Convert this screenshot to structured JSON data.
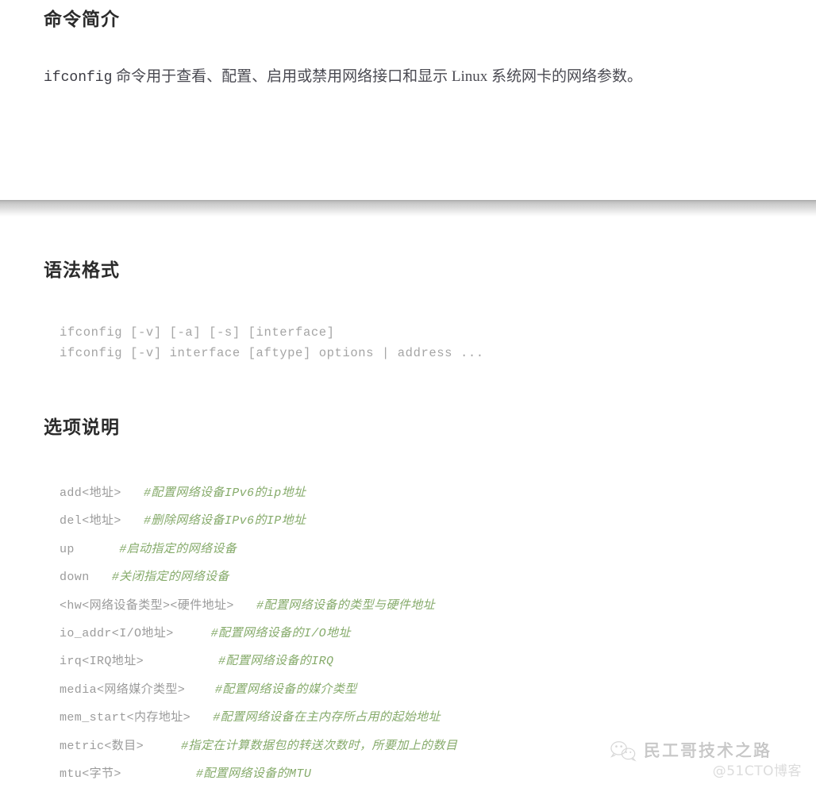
{
  "document": {
    "background_color": "#ffffff",
    "heading_color": "#2b2b2b",
    "body_color": "#4a4a52",
    "code_color": "#a5a5a5",
    "option_name_color": "#9b9b9b",
    "comment_color": "#86ab6b"
  },
  "intro": {
    "heading": "命令简介",
    "command_name": "ifconfig",
    "paragraph_rest": " 命令用于查看、配置、启用或禁用网络接口和显示 Linux 系统网卡的网络参数。"
  },
  "syntax": {
    "heading": "语法格式",
    "lines": [
      "ifconfig [-v] [-a] [-s] [interface]",
      "ifconfig [-v] interface [aftype] options | address ..."
    ],
    "code_text": "ifconfig [-v] [-a] [-s] [interface]\nifconfig [-v] interface [aftype] options | address ..."
  },
  "options": {
    "heading": "选项说明",
    "rows": [
      {
        "name": "add<地址>",
        "gap": "   ",
        "comment": "#配置网络设备IPv6的ip地址"
      },
      {
        "name": "del<地址>",
        "gap": "   ",
        "comment": "#删除网络设备IPv6的IP地址"
      },
      {
        "name": "up",
        "gap": "      ",
        "comment": "#启动指定的网络设备"
      },
      {
        "name": "down",
        "gap": "   ",
        "comment": "#关闭指定的网络设备"
      },
      {
        "name": "<hw<网络设备类型><硬件地址>",
        "gap": "   ",
        "comment": "#配置网络设备的类型与硬件地址"
      },
      {
        "name": "io_addr<I/O地址>",
        "gap": "     ",
        "comment": "#配置网络设备的I/O地址"
      },
      {
        "name": "irq<IRQ地址>",
        "gap": "          ",
        "comment": "#配置网络设备的IRQ"
      },
      {
        "name": "media<网络媒介类型>",
        "gap": "    ",
        "comment": "#配置网络设备的媒介类型"
      },
      {
        "name": "mem_start<内存地址>",
        "gap": "   ",
        "comment": "#配置网络设备在主内存所占用的起始地址"
      },
      {
        "name": "metric<数目>",
        "gap": "     ",
        "comment": "#指定在计算数据包的转送次数时，所要加上的数目"
      },
      {
        "name": "mtu<字节>",
        "gap": "          ",
        "comment": "#配置网络设备的MTU"
      }
    ]
  },
  "watermark": {
    "icon": "wechat-icon",
    "title": "民工哥技术之路",
    "subtitle": "@51CTO博客"
  }
}
